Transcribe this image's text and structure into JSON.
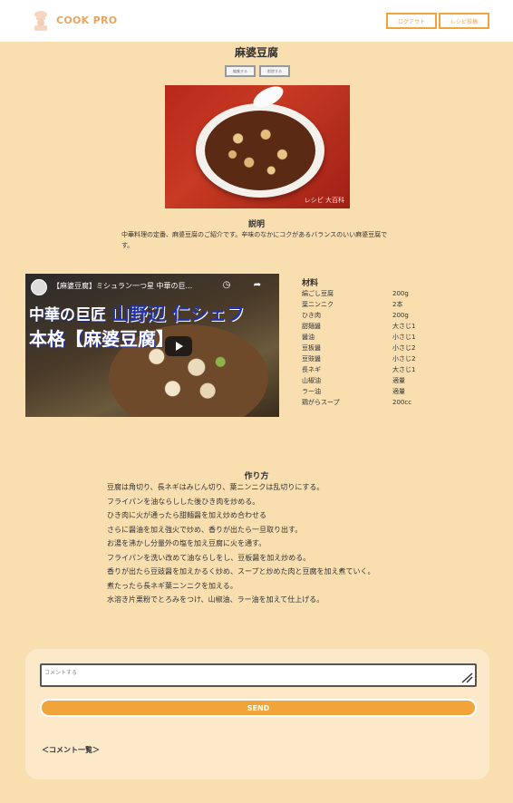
{
  "header": {
    "logo_text": "COOK PRO",
    "logout_label": "ログアウト",
    "post_label": "レシピ投稿"
  },
  "recipe": {
    "title": "麻婆豆腐",
    "edit_label": "編集する",
    "delete_label": "削除する",
    "photo_watermark": "レシピ 大百科",
    "description_heading": "説明",
    "description": "中華料理の定番、麻婆豆腐のご紹介です。辛味のなかにコクがあるバランスのいい麻婆豆腐です。"
  },
  "video": {
    "title": "【麻婆豆腐】ミシュラン一つ星 中華の巨...",
    "overlay_line1_a": "中華の巨匠",
    "overlay_line1_b": "山野辺 仁シェフ",
    "overlay_line2": "本格【麻婆豆腐】"
  },
  "ingredients": {
    "heading": "材料",
    "items": [
      {
        "name": "絹ごし豆腐",
        "qty": "200g"
      },
      {
        "name": "葉ニンニク",
        "qty": "2本"
      },
      {
        "name": "ひき肉",
        "qty": "200g"
      },
      {
        "name": "甜麺醤",
        "qty": "大さじ1"
      },
      {
        "name": "醤油",
        "qty": "小さじ1"
      },
      {
        "name": "豆板醤",
        "qty": "小さじ2"
      },
      {
        "name": "豆豉醤",
        "qty": "小さじ2"
      },
      {
        "name": "長ネギ",
        "qty": "大さじ1"
      },
      {
        "name": "山椒油",
        "qty": "適量"
      },
      {
        "name": "ラー油",
        "qty": "適量"
      },
      {
        "name": "鶏がらスープ",
        "qty": "200cc"
      }
    ]
  },
  "howto": {
    "heading": "作り方",
    "steps": [
      "豆腐は角切り、長ネギはみじん切り、葉ニンニクは乱切りにする。",
      "フライパンを油ならしした後ひき肉を炒める。",
      "ひき肉に火が通ったら甜麺醤を加え炒め合わせる",
      "さらに醤油を加え強火で炒め、香りが出たら一旦取り出す。",
      "お湯を沸かし分量外の塩を加え豆腐に火を通す。",
      "フライパンを洗い改めて油ならしをし、豆板醤を加え炒める。",
      "香りが出たら豆豉醤を加えかるく炒め、スープと炒めた肉と豆腐を加え煮ていく。",
      "煮たったら長ネギ葉ニンニクを加える。",
      "水溶き片栗粉でとろみをつけ、山椒油、ラー油を加えて仕上げる。"
    ]
  },
  "comments": {
    "placeholder": "コメントする",
    "send_label": "SEND",
    "list_label": "＜コメント一覧＞"
  },
  "colors": {
    "background": "#f9deb0",
    "accent": "#f0a43a"
  }
}
